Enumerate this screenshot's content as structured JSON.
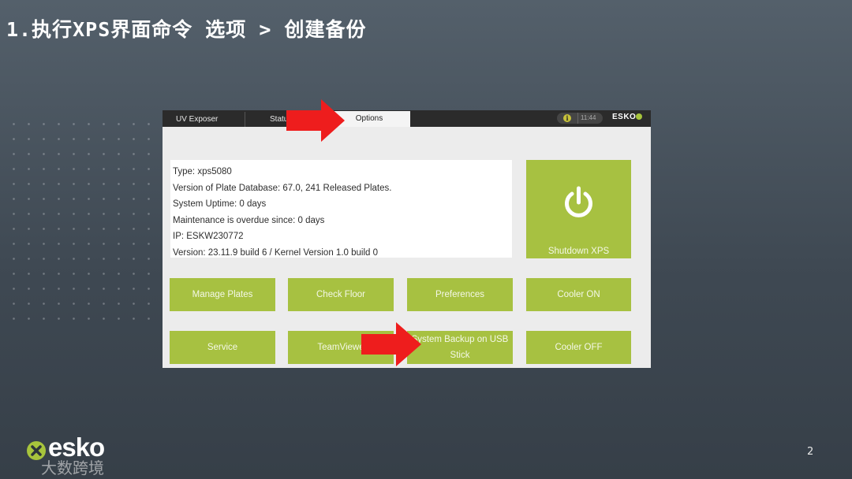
{
  "slide": {
    "title": "1.执行XPS界面命令 选项 > 创建备份",
    "page_number": "2"
  },
  "tabs": {
    "uv_exposer": "UV Exposer",
    "status": "Statu",
    "options": "Options"
  },
  "status_bar": {
    "info_glyph": "i",
    "time": "11:44",
    "brand": "ESKO"
  },
  "system_info": {
    "lines": [
      "Type: xps5080",
      "Version of Plate Database: 67.0, 241 Released Plates.",
      "System Uptime: 0 days",
      "Maintenance is overdue since:  0 days",
      "IP: ESKW230772",
      "Version: 23.11.9 build 6 / Kernel Version 1.0 build 0"
    ]
  },
  "buttons": {
    "shutdown": "Shutdown XPS",
    "manage_plates": "Manage Plates",
    "check_floor": "Check Floor",
    "preferences": "Preferences",
    "cooler_on": "Cooler ON",
    "service": "Service",
    "teamviewer": "TeamViewe",
    "backup_line1": "System Backup on USB",
    "backup_line2": "Stick",
    "cooler_off": "Cooler OFF"
  },
  "footer": {
    "logo_text": "esko",
    "watermark": "大数跨境"
  },
  "colors": {
    "button_green": "#a7c141",
    "arrow_red": "#ee1d1d",
    "tabbar_dark": "#2b2b2b"
  },
  "icons": [
    "power-icon",
    "info-icon",
    "esko-logo-icon",
    "pointer-arrow-icon"
  ]
}
